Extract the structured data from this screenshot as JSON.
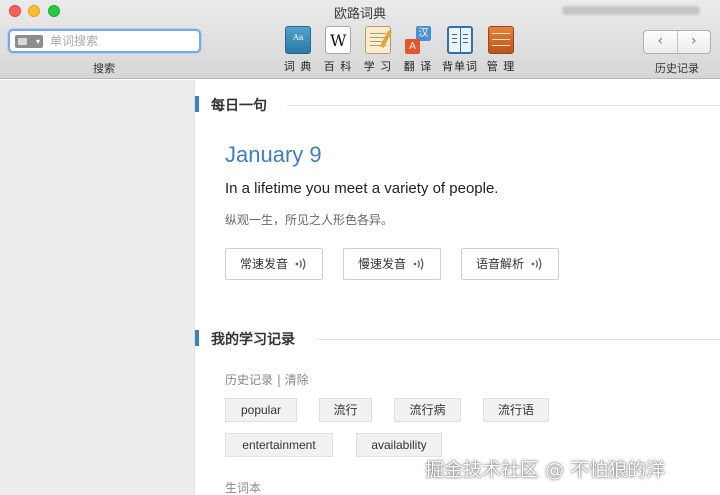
{
  "window": {
    "title": "欧路词典"
  },
  "search": {
    "placeholder": "单词搜索",
    "caption": "搜索"
  },
  "toolbar": {
    "tools": [
      {
        "label": "词 典",
        "icon": "dictionary-icon"
      },
      {
        "label": "百 科",
        "icon": "wikipedia-icon"
      },
      {
        "label": "学 习",
        "icon": "study-notebook-icon"
      },
      {
        "label": "翻 译",
        "icon": "translate-icon",
        "glyph_top": "汉",
        "glyph_bottom": "A"
      },
      {
        "label": "背单词",
        "icon": "vocabulary-book-icon"
      },
      {
        "label": "管 理",
        "icon": "manage-icon"
      }
    ],
    "history": {
      "caption": "历史记录",
      "back": "‹",
      "forward": "›"
    }
  },
  "daily": {
    "section_title": "每日一句",
    "date": "January 9",
    "sentence_en": "In a lifetime you meet a variety of people.",
    "sentence_cn": "纵观一生，所见之人形色各异。",
    "buttons": [
      "常速发音",
      "慢速发音",
      "语音解析"
    ]
  },
  "records": {
    "section_title": "我的学习记录",
    "history_label": "历史记录",
    "separator": " | ",
    "clear_label": "清除",
    "history_words": [
      "popular",
      "流行",
      "流行病",
      "流行语",
      "entertainment",
      "availability"
    ],
    "vocab_title": "生词本"
  },
  "watermark": "掘金技术社区 @ 不怕狼的洋",
  "colors": {
    "accent": "#3d7fc7",
    "sidebar": "#ededed"
  }
}
